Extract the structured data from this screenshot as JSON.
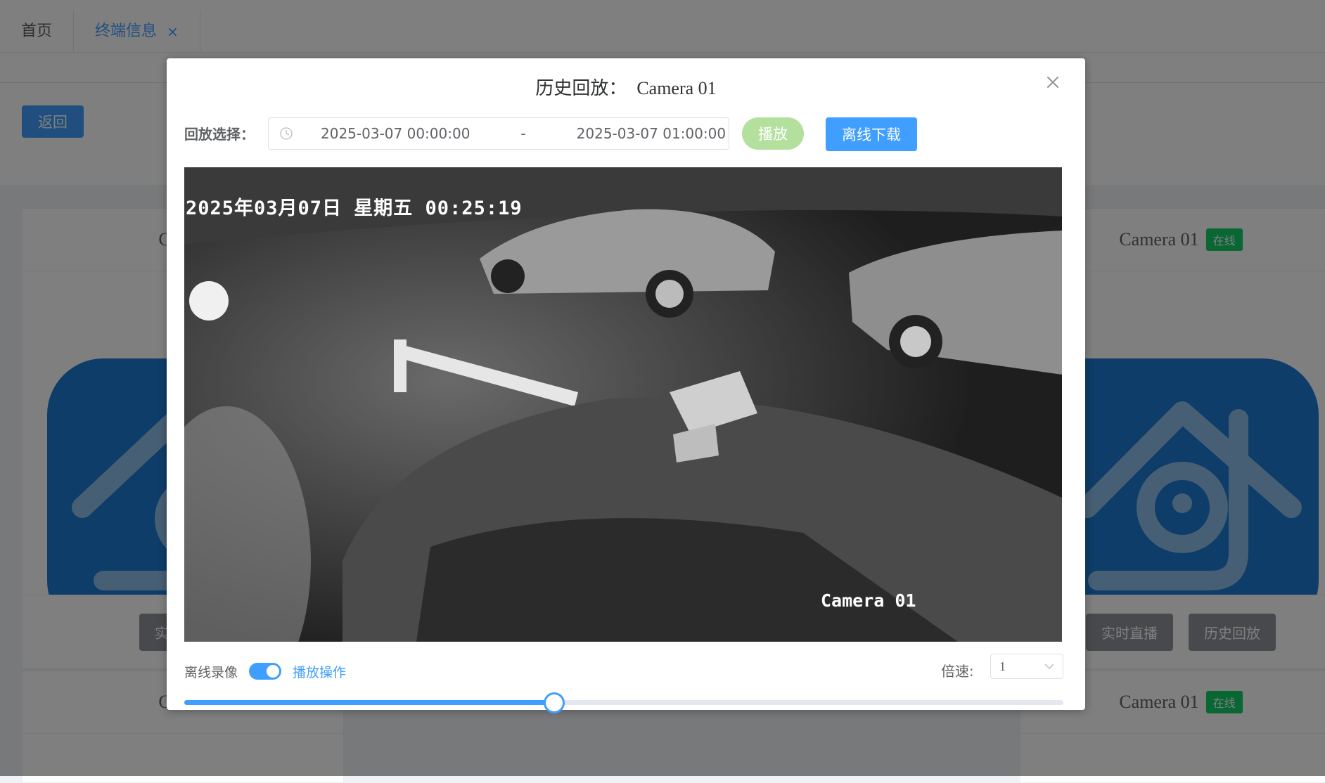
{
  "tabs": [
    {
      "label": "首页"
    },
    {
      "label": "终端信息",
      "close": "×"
    }
  ],
  "toolbar": {
    "back_label": "返回"
  },
  "cards": {
    "top_left_title": "Camer",
    "top_right_title": "Camera 01",
    "top_right_status": "在线",
    "bottom_left_title": "Camer",
    "bottom_right_title": "Camera 01",
    "bottom_right_status": "在线",
    "live_label": "实时直播",
    "history_label": "历史回放"
  },
  "dialog": {
    "title": "历史回放：",
    "camera_name": "Camera 01",
    "range_label": "回放选择：",
    "start_time": "2025-03-07 00:00:00",
    "range_separator": "-",
    "end_time": "2025-03-07 01:00:00",
    "play_label": "播放",
    "download_label": "离线下载",
    "osd_timestamp": "2025年03月07日  星期五  00:25:19",
    "osd_camera": "Camera 01",
    "offline_label": "离线录像",
    "offline_enabled": true,
    "play_ops_label": "播放操作",
    "speed_label": "倍速:",
    "speed_value": "1",
    "progress_fraction": 0.42
  },
  "colors": {
    "primary": "#409eff",
    "success": "#13ce66",
    "play_disabled": "#b3e19d"
  }
}
